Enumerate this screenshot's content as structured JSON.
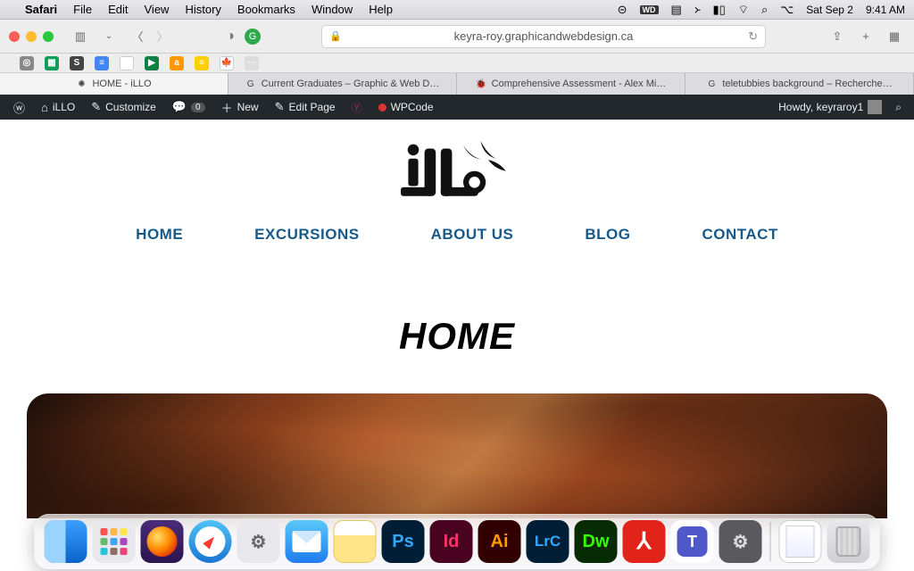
{
  "menubar": {
    "app": "Safari",
    "items": [
      "File",
      "Edit",
      "View",
      "History",
      "Bookmarks",
      "Window",
      "Help"
    ],
    "status_date": "Sat Sep 2",
    "status_time": "9:41 AM"
  },
  "safari": {
    "url": "keyra-roy.graphicandwebdesign.ca"
  },
  "favorites": [
    {
      "bg": "#888",
      "txt": "◎"
    },
    {
      "bg": "#0f9d58",
      "txt": "▦"
    },
    {
      "bg": "#444",
      "txt": "S"
    },
    {
      "bg": "#4285f4",
      "txt": "≡"
    },
    {
      "bg": "#fff",
      "txt": ""
    },
    {
      "bg": "#0b8043",
      "txt": "▶"
    },
    {
      "bg": "#ff9900",
      "txt": "a"
    },
    {
      "bg": "#ffcf00",
      "txt": "≡"
    },
    {
      "bg": "#fff",
      "txt": "🍁"
    },
    {
      "bg": "#ddd",
      "txt": "⋯"
    }
  ],
  "tabs": [
    {
      "label": "HOME - iLLO",
      "icon": "✺",
      "active": true
    },
    {
      "label": "Current Graduates – Graphic & Web D…",
      "icon": "G",
      "active": false
    },
    {
      "label": "Comprehensive Assessment - Alex Mi…",
      "icon": "🐞",
      "active": false
    },
    {
      "label": "teletubbies background – Recherche…",
      "icon": "G",
      "active": false
    }
  ],
  "wp": {
    "site": "iLLO",
    "customize": "Customize",
    "comments": "0",
    "new": "New",
    "edit": "Edit Page",
    "wpcode": "WPCode",
    "howdy": "Howdy, keyraroy1"
  },
  "site": {
    "nav": [
      "HOME",
      "EXCURSIONS",
      "ABOUT US",
      "BLOG",
      "CONTACT"
    ],
    "title": "HOME"
  },
  "dock": {
    "apps": [
      {
        "name": "finder",
        "label": ""
      },
      {
        "name": "launchpad",
        "label": ""
      },
      {
        "name": "firefox",
        "label": ""
      },
      {
        "name": "safari",
        "label": ""
      },
      {
        "name": "system-settings",
        "label": ""
      },
      {
        "name": "mail",
        "label": ""
      },
      {
        "name": "notes",
        "label": ""
      },
      {
        "name": "photoshop",
        "label": "Ps"
      },
      {
        "name": "indesign",
        "label": "Id"
      },
      {
        "name": "illustrator",
        "label": "Ai"
      },
      {
        "name": "lightroom",
        "label": "LrC"
      },
      {
        "name": "dreamweaver",
        "label": "Dw"
      },
      {
        "name": "acrobat",
        "label": "A"
      },
      {
        "name": "teams",
        "label": "𝘁"
      },
      {
        "name": "settings",
        "label": "⚙"
      }
    ]
  }
}
